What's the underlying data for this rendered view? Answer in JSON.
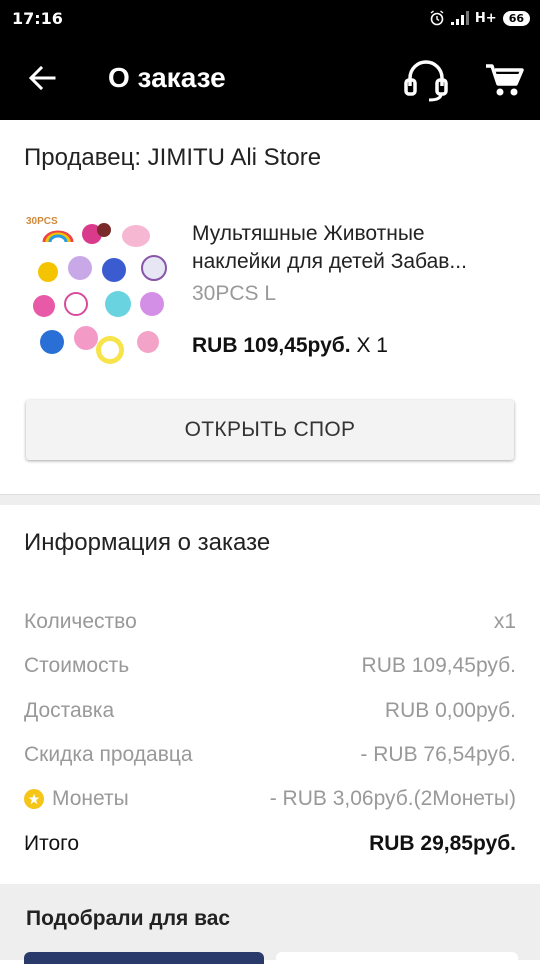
{
  "status_bar": {
    "time": "17:16",
    "network": "H+",
    "battery": "66"
  },
  "app_bar": {
    "title": "О заказе"
  },
  "order": {
    "seller_label": "Продавец: JIMITU Ali Store",
    "product": {
      "thumbnail_text": "30PCS",
      "name_line1": "Мультяшные Животные",
      "name_line2": "наклейки для детей Забав...",
      "variant": "30PCS L",
      "price": "RUB 109,45руб.",
      "qty": " X 1"
    },
    "dispute_button": "ОТКРЫТЬ СПОР"
  },
  "info": {
    "title": "Информация о заказе",
    "rows": [
      {
        "label": "Количество",
        "value": "x1"
      },
      {
        "label": "Стоимость",
        "value": "RUB 109,45руб."
      },
      {
        "label": "Доставка",
        "value": "RUB 0,00руб."
      },
      {
        "label": "Скидка продавца",
        "value": "- RUB 76,54руб."
      },
      {
        "label": "Монеты",
        "value": "- RUB 3,06руб.(2Монеты)"
      },
      {
        "label": "Итого",
        "value": "RUB 29,85руб."
      }
    ]
  },
  "recommendations": {
    "title": "Подобрали для вас"
  },
  "icons": {
    "back": "arrow-left-icon",
    "support": "headset-icon",
    "cart": "cart-icon",
    "coin": "coin-icon"
  },
  "colors": {
    "appbar": "#000000",
    "coin": "#f5c518",
    "muted_text": "#999999"
  }
}
